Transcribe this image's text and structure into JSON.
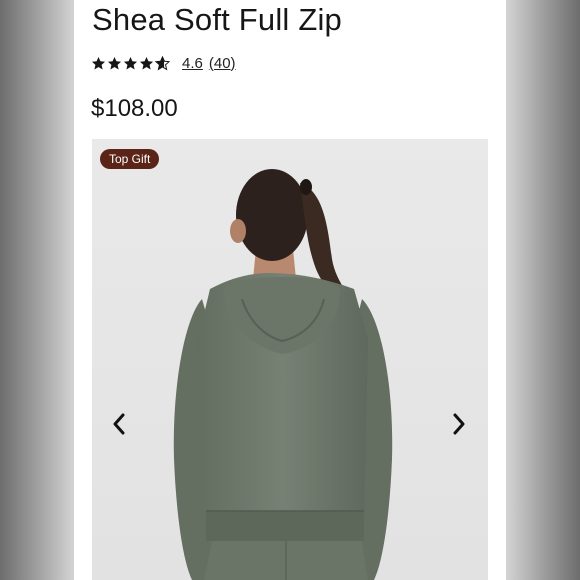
{
  "product": {
    "title": "Shea Soft Full Zip",
    "rating_value": "4.6",
    "review_count": "(40)",
    "rating_stars": 4.6,
    "price": "$108.00"
  },
  "gallery": {
    "badge": "Top Gift",
    "prev_icon": "chevron-left-icon",
    "next_icon": "chevron-right-icon"
  },
  "colors": {
    "badge_bg": "#5a2416",
    "hoodie": "#6f7a6c",
    "text": "#161616"
  }
}
